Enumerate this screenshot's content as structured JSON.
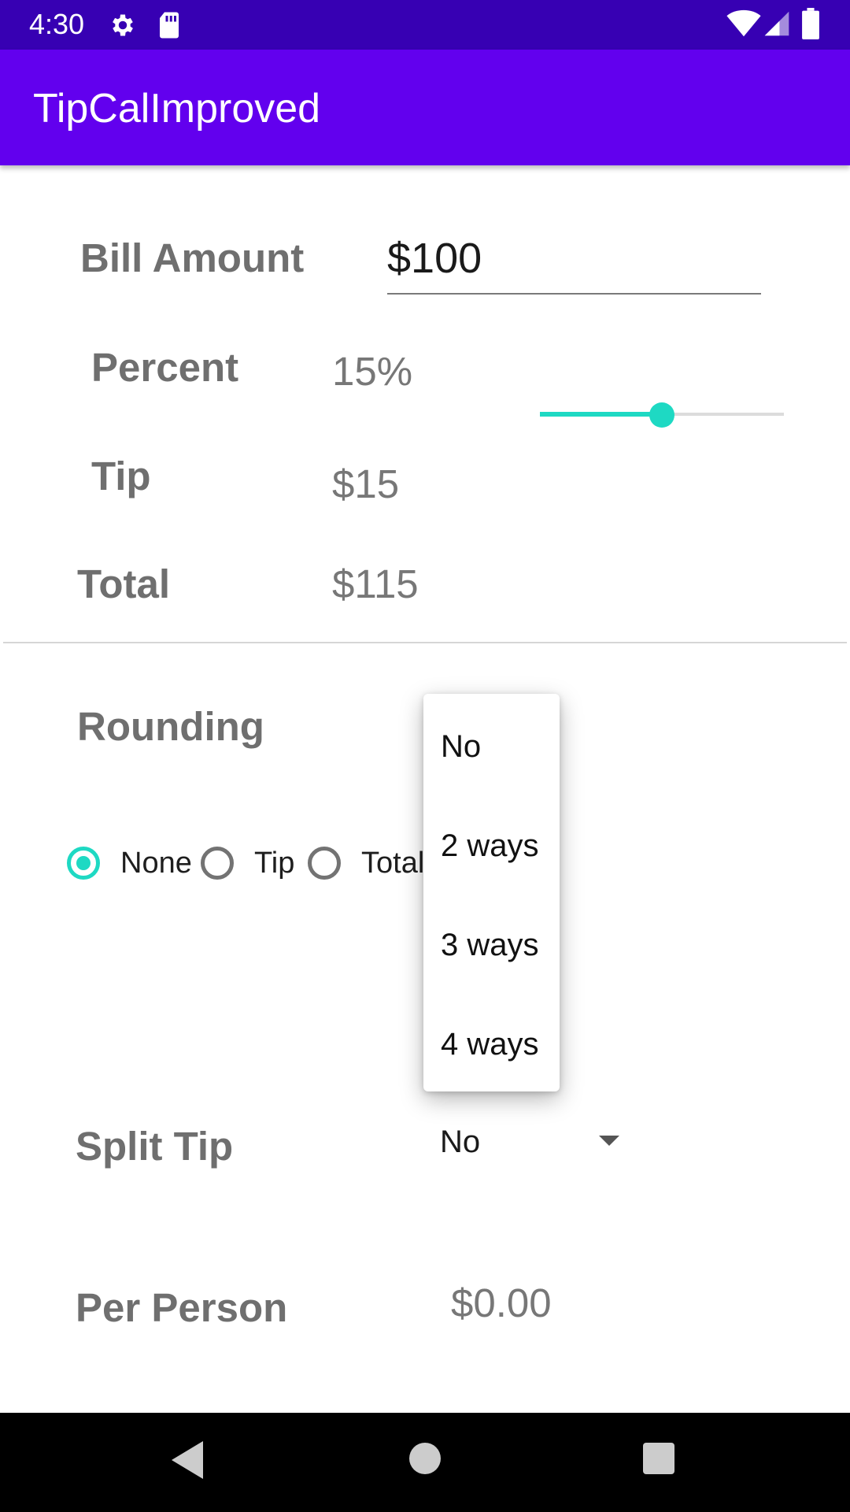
{
  "status_bar": {
    "time": "4:30",
    "icons": [
      "gear-icon",
      "sd-card-icon",
      "wifi-icon",
      "signal-icon",
      "battery-icon"
    ]
  },
  "app_bar": {
    "title": "TipCalImproved"
  },
  "bill": {
    "label": "Bill Amount",
    "value": "$100"
  },
  "percent": {
    "label": "Percent",
    "value": "15%",
    "slider_fraction": 0.5
  },
  "tip": {
    "label": "Tip",
    "value": "$15"
  },
  "total": {
    "label": "Total",
    "value": "$115"
  },
  "rounding": {
    "label": "Rounding",
    "options": [
      {
        "label": "None",
        "checked": true
      },
      {
        "label": "Tip",
        "checked": false
      },
      {
        "label": "Total",
        "checked": false
      }
    ]
  },
  "split_tip": {
    "label": "Split Tip",
    "selected": "No",
    "dropdown_options": [
      "No",
      "2 ways",
      "3 ways",
      "4 ways"
    ]
  },
  "per_person": {
    "label": "Per Person",
    "value": "$0.00"
  },
  "colors": {
    "status_bar": "#3700b3",
    "app_bar": "#6200ee",
    "accent": "#1ed9c3"
  },
  "nav_bar": {
    "icons": [
      "back-icon",
      "home-icon",
      "recents-icon"
    ]
  }
}
